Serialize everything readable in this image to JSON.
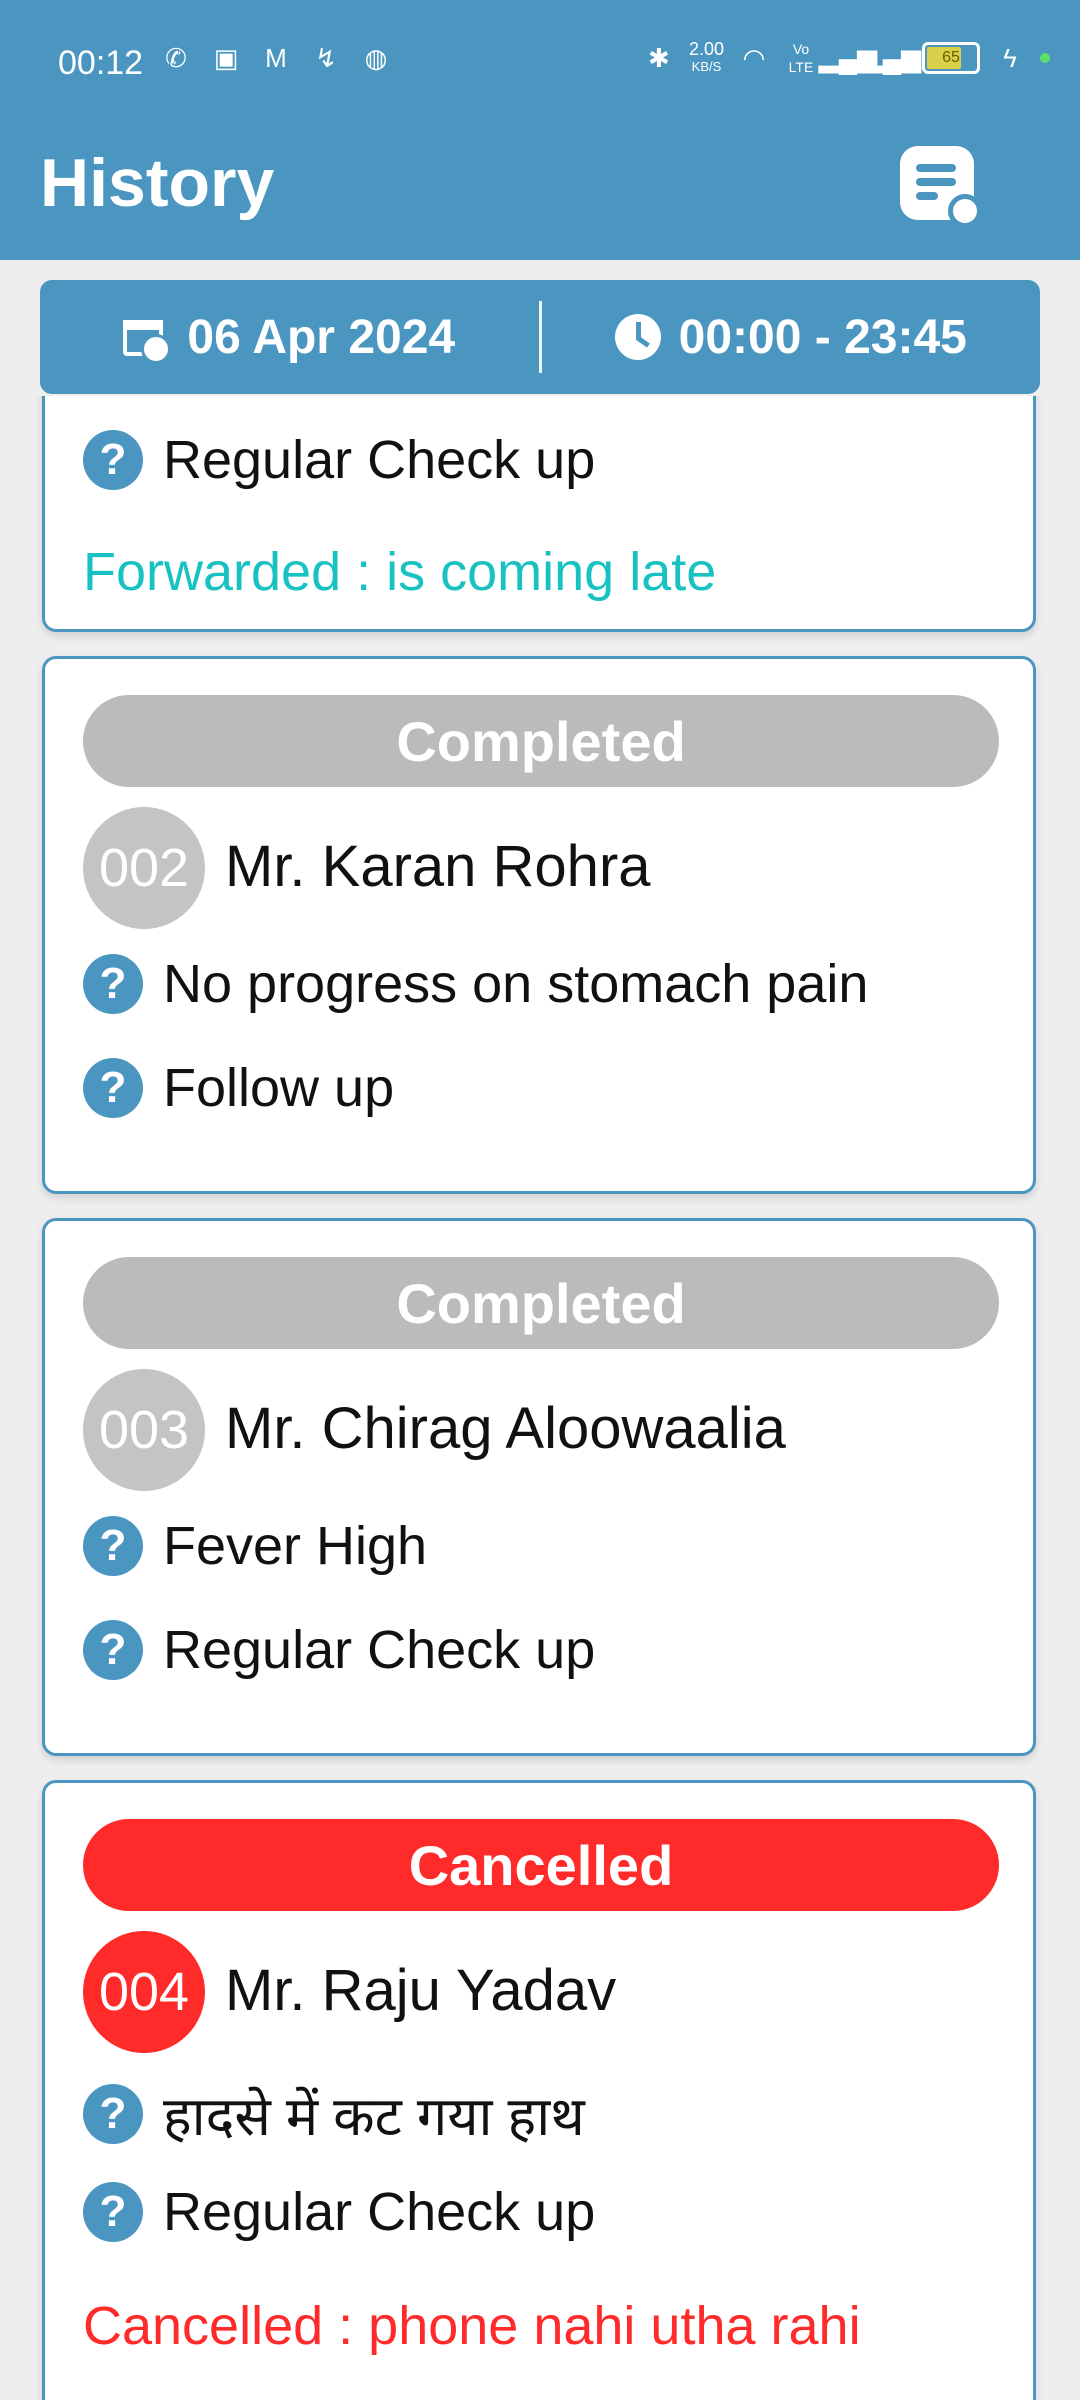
{
  "status_bar": {
    "time": "00:12",
    "speed_value": "2.00",
    "speed_unit": "KB/S",
    "volte": "Vo LTE",
    "battery": "65"
  },
  "app_bar": {
    "title": "History"
  },
  "filter": {
    "date": "06 Apr 2024",
    "time_range": "00:00 - 23:45"
  },
  "cards": [
    {
      "reasons": [
        "Regular Check up"
      ],
      "note": "Forwarded : is coming late",
      "note_color": "#19c2c2"
    },
    {
      "status": "Completed",
      "token": "002",
      "name": "Mr. Karan Rohra",
      "reasons": [
        "No progress on stomach pain",
        "Follow up"
      ]
    },
    {
      "status": "Completed",
      "token": "003",
      "name": "Mr. Chirag Aloowaalia",
      "reasons": [
        "Fever High",
        "Regular Check up"
      ]
    },
    {
      "status": "Cancelled",
      "token": "004",
      "name": "Mr. Raju Yadav",
      "reasons": [
        "हादसे में कट गया हाथ",
        "Regular Check up"
      ],
      "note": "Cancelled : phone nahi utha rahi",
      "note_color": "#ff2a2a"
    }
  ],
  "colors": {
    "primary": "#4a96c0",
    "completed": "#bbbbbb",
    "cancelled": "#ff2a2a",
    "forwarded": "#19c2c2"
  }
}
